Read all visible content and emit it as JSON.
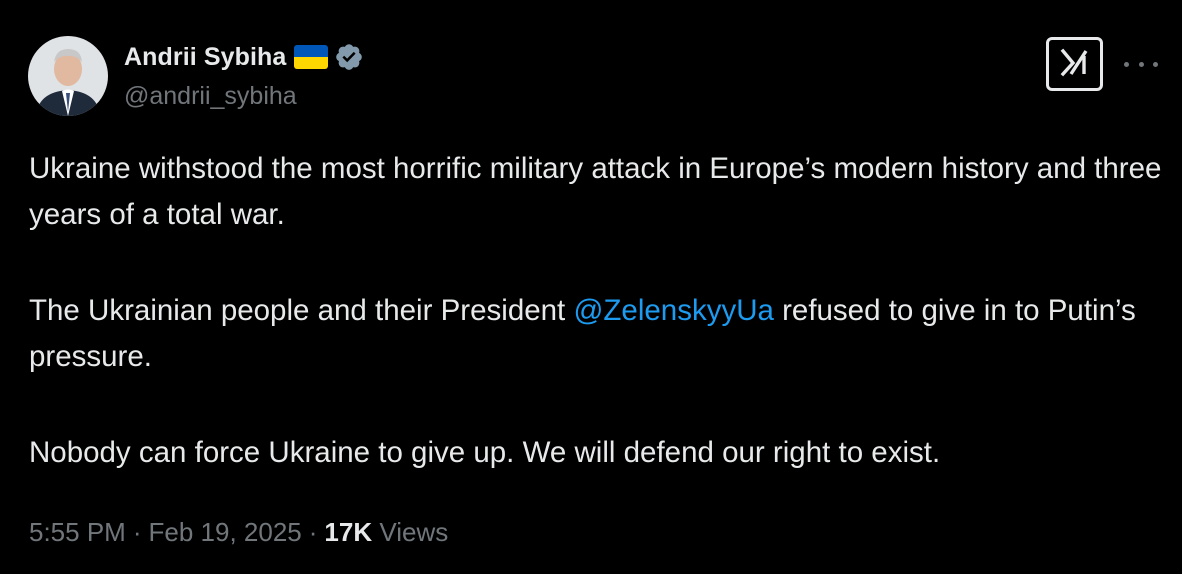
{
  "author": {
    "display_name": "Andrii Sybiha",
    "handle": "@andrii_sybiha",
    "flag": "ukraine-flag",
    "verified": true
  },
  "tweet": {
    "para1": "Ukraine withstood the most horrific military attack in Europe’s modern history and three years of a total war.",
    "para2_before": "The Ukrainian people and their President ",
    "mention": "@ZelenskyyUa",
    "para2_after": " refused to give in to Putin’s pressure.",
    "para3": "Nobody can force Ukraine to give up. We will defend our right to exist."
  },
  "meta": {
    "time": "5:55 PM",
    "date": "Feb 19, 2025",
    "separator": "·",
    "views_count": "17K",
    "views_label": "Views"
  },
  "colors": {
    "background": "#000000",
    "text": "#e7e9ea",
    "secondary": "#71767b",
    "link": "#1d9bf0",
    "verified": "#829aab"
  },
  "icons": {
    "grok": "grok-icon",
    "more": "more-icon",
    "verified": "verified-badge-icon"
  }
}
